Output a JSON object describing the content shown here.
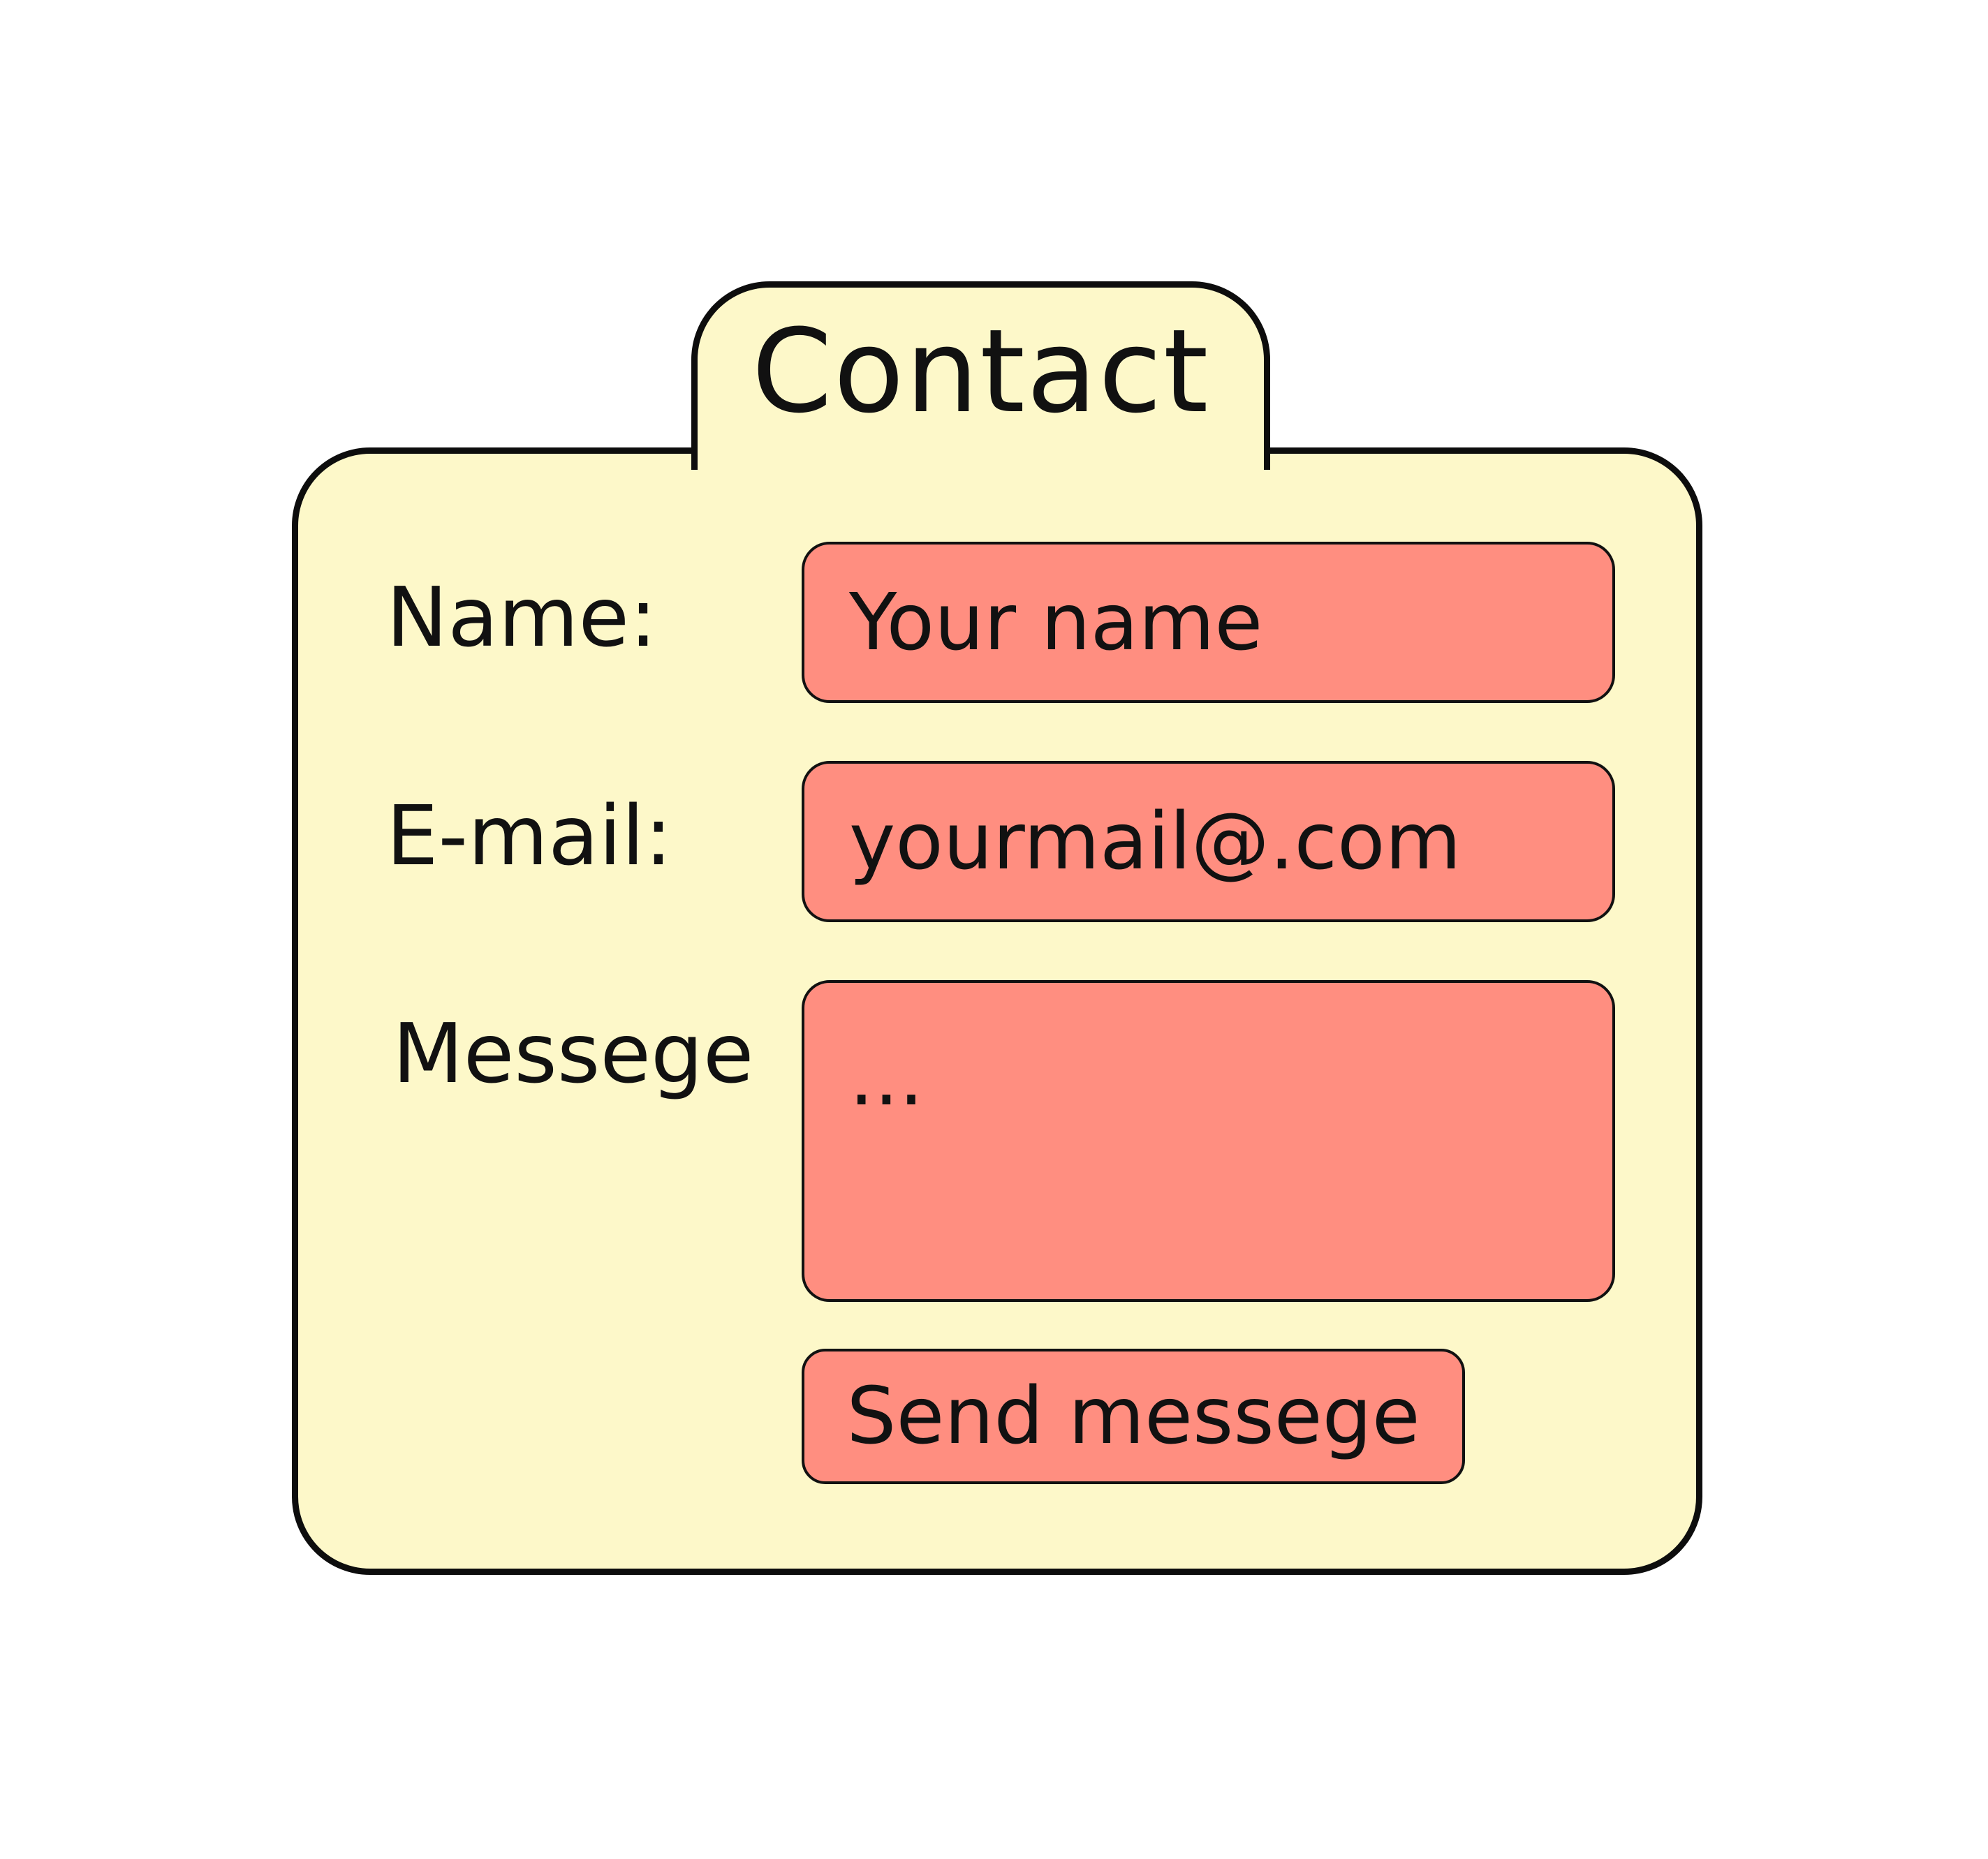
{
  "form": {
    "title": "Contact",
    "name": {
      "label": "Name:",
      "placeholder": "Your name"
    },
    "email": {
      "label": "E-mail:",
      "placeholder": "yourmail@.com"
    },
    "message": {
      "label": "Messege",
      "placeholder": "..."
    },
    "submit_label": "Send messege"
  },
  "colors": {
    "panel_background": "#fdf8c9",
    "field_background": "#ff8e80",
    "border": "#0d0d0d",
    "text": "#111111"
  }
}
